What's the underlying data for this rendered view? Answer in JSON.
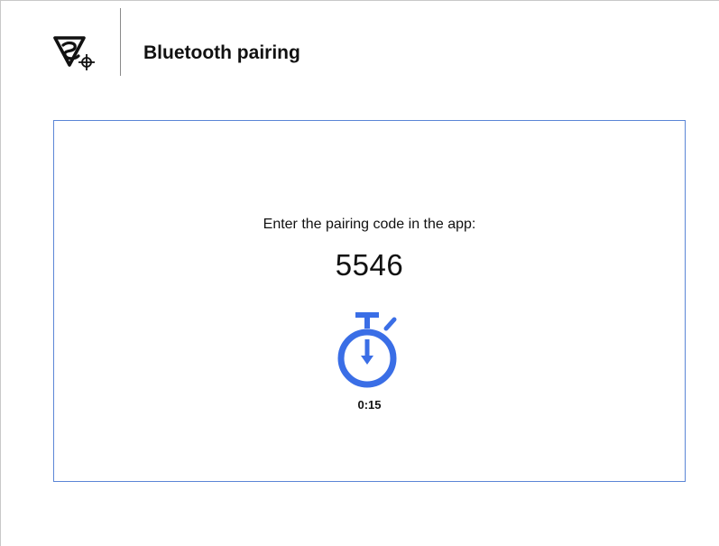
{
  "header": {
    "logo_icon": "brand-logo-icon",
    "title": "Bluetooth pairing"
  },
  "pairing": {
    "instruction": "Enter the pairing code in the app:",
    "code": "5546",
    "timer_icon": "stopwatch-icon",
    "countdown": "0:15"
  },
  "colors": {
    "accent": "#3a6ee6",
    "panel_border": "#5b86d6",
    "text": "#111111"
  }
}
